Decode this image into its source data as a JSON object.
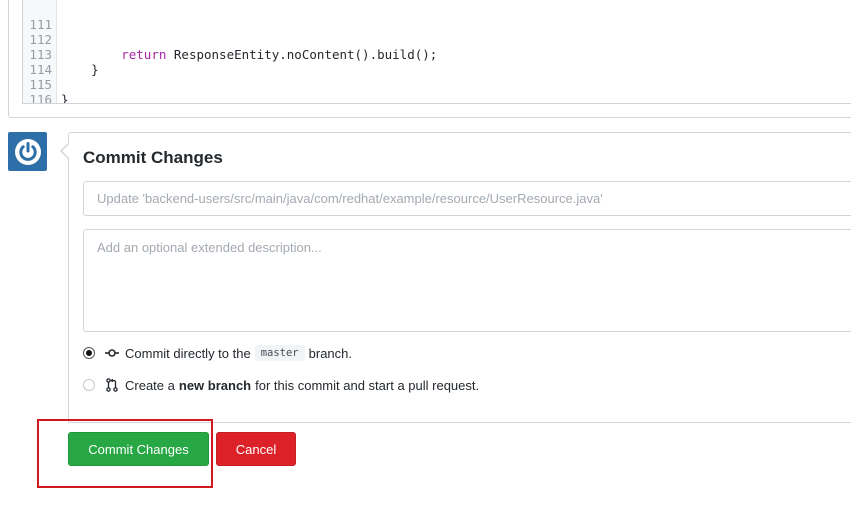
{
  "code": {
    "lines": [
      {
        "num": "111",
        "text": ""
      },
      {
        "num": "112",
        "indent": "        ",
        "keyword": "return",
        "rest": " ResponseEntity.noContent().build();"
      },
      {
        "num": "113",
        "text": "    }"
      },
      {
        "num": "114",
        "text": ""
      },
      {
        "num": "115",
        "text": "}"
      },
      {
        "num": "116",
        "text": ""
      }
    ]
  },
  "avatar": {
    "icon": "power-icon",
    "color": "#2d6fa8"
  },
  "commit_form": {
    "title": "Commit Changes",
    "summary_placeholder": "Update 'backend-users/src/main/java/com/redhat/example/resource/UserResource.java'",
    "summary_value": "",
    "description_placeholder": "Add an optional extended description...",
    "description_value": "",
    "options": {
      "direct": {
        "selected": true,
        "icon": "git-commit-icon",
        "prefix": "Commit directly to the",
        "branch": "master",
        "suffix": "branch."
      },
      "new_branch": {
        "selected": false,
        "icon": "git-pull-request-icon",
        "prefix": "Create a",
        "emphasis": "new branch",
        "suffix": "for this commit and start a pull request."
      }
    },
    "buttons": {
      "commit_label": "Commit Changes",
      "cancel_label": "Cancel"
    }
  },
  "colors": {
    "commit_button": "#28a745",
    "cancel_button": "#dc2129",
    "highlight_box": "#d0181f",
    "keyword": "#a626a4"
  }
}
